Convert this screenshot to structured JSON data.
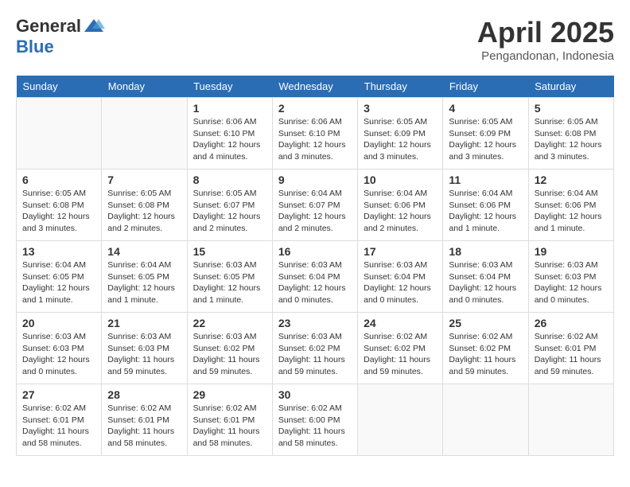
{
  "header": {
    "logo_general": "General",
    "logo_blue": "Blue",
    "month_year": "April 2025",
    "location": "Pengandonan, Indonesia"
  },
  "calendar": {
    "days_of_week": [
      "Sunday",
      "Monday",
      "Tuesday",
      "Wednesday",
      "Thursday",
      "Friday",
      "Saturday"
    ],
    "weeks": [
      [
        {
          "day": "",
          "info": ""
        },
        {
          "day": "",
          "info": ""
        },
        {
          "day": "1",
          "info": "Sunrise: 6:06 AM\nSunset: 6:10 PM\nDaylight: 12 hours\nand 4 minutes."
        },
        {
          "day": "2",
          "info": "Sunrise: 6:06 AM\nSunset: 6:10 PM\nDaylight: 12 hours\nand 3 minutes."
        },
        {
          "day": "3",
          "info": "Sunrise: 6:05 AM\nSunset: 6:09 PM\nDaylight: 12 hours\nand 3 minutes."
        },
        {
          "day": "4",
          "info": "Sunrise: 6:05 AM\nSunset: 6:09 PM\nDaylight: 12 hours\nand 3 minutes."
        },
        {
          "day": "5",
          "info": "Sunrise: 6:05 AM\nSunset: 6:08 PM\nDaylight: 12 hours\nand 3 minutes."
        }
      ],
      [
        {
          "day": "6",
          "info": "Sunrise: 6:05 AM\nSunset: 6:08 PM\nDaylight: 12 hours\nand 3 minutes."
        },
        {
          "day": "7",
          "info": "Sunrise: 6:05 AM\nSunset: 6:08 PM\nDaylight: 12 hours\nand 2 minutes."
        },
        {
          "day": "8",
          "info": "Sunrise: 6:05 AM\nSunset: 6:07 PM\nDaylight: 12 hours\nand 2 minutes."
        },
        {
          "day": "9",
          "info": "Sunrise: 6:04 AM\nSunset: 6:07 PM\nDaylight: 12 hours\nand 2 minutes."
        },
        {
          "day": "10",
          "info": "Sunrise: 6:04 AM\nSunset: 6:06 PM\nDaylight: 12 hours\nand 2 minutes."
        },
        {
          "day": "11",
          "info": "Sunrise: 6:04 AM\nSunset: 6:06 PM\nDaylight: 12 hours\nand 1 minute."
        },
        {
          "day": "12",
          "info": "Sunrise: 6:04 AM\nSunset: 6:06 PM\nDaylight: 12 hours\nand 1 minute."
        }
      ],
      [
        {
          "day": "13",
          "info": "Sunrise: 6:04 AM\nSunset: 6:05 PM\nDaylight: 12 hours\nand 1 minute."
        },
        {
          "day": "14",
          "info": "Sunrise: 6:04 AM\nSunset: 6:05 PM\nDaylight: 12 hours\nand 1 minute."
        },
        {
          "day": "15",
          "info": "Sunrise: 6:03 AM\nSunset: 6:05 PM\nDaylight: 12 hours\nand 1 minute."
        },
        {
          "day": "16",
          "info": "Sunrise: 6:03 AM\nSunset: 6:04 PM\nDaylight: 12 hours\nand 0 minutes."
        },
        {
          "day": "17",
          "info": "Sunrise: 6:03 AM\nSunset: 6:04 PM\nDaylight: 12 hours\nand 0 minutes."
        },
        {
          "day": "18",
          "info": "Sunrise: 6:03 AM\nSunset: 6:04 PM\nDaylight: 12 hours\nand 0 minutes."
        },
        {
          "day": "19",
          "info": "Sunrise: 6:03 AM\nSunset: 6:03 PM\nDaylight: 12 hours\nand 0 minutes."
        }
      ],
      [
        {
          "day": "20",
          "info": "Sunrise: 6:03 AM\nSunset: 6:03 PM\nDaylight: 12 hours\nand 0 minutes."
        },
        {
          "day": "21",
          "info": "Sunrise: 6:03 AM\nSunset: 6:03 PM\nDaylight: 11 hours\nand 59 minutes."
        },
        {
          "day": "22",
          "info": "Sunrise: 6:03 AM\nSunset: 6:02 PM\nDaylight: 11 hours\nand 59 minutes."
        },
        {
          "day": "23",
          "info": "Sunrise: 6:03 AM\nSunset: 6:02 PM\nDaylight: 11 hours\nand 59 minutes."
        },
        {
          "day": "24",
          "info": "Sunrise: 6:02 AM\nSunset: 6:02 PM\nDaylight: 11 hours\nand 59 minutes."
        },
        {
          "day": "25",
          "info": "Sunrise: 6:02 AM\nSunset: 6:02 PM\nDaylight: 11 hours\nand 59 minutes."
        },
        {
          "day": "26",
          "info": "Sunrise: 6:02 AM\nSunset: 6:01 PM\nDaylight: 11 hours\nand 59 minutes."
        }
      ],
      [
        {
          "day": "27",
          "info": "Sunrise: 6:02 AM\nSunset: 6:01 PM\nDaylight: 11 hours\nand 58 minutes."
        },
        {
          "day": "28",
          "info": "Sunrise: 6:02 AM\nSunset: 6:01 PM\nDaylight: 11 hours\nand 58 minutes."
        },
        {
          "day": "29",
          "info": "Sunrise: 6:02 AM\nSunset: 6:01 PM\nDaylight: 11 hours\nand 58 minutes."
        },
        {
          "day": "30",
          "info": "Sunrise: 6:02 AM\nSunset: 6:00 PM\nDaylight: 11 hours\nand 58 minutes."
        },
        {
          "day": "",
          "info": ""
        },
        {
          "day": "",
          "info": ""
        },
        {
          "day": "",
          "info": ""
        }
      ]
    ]
  }
}
